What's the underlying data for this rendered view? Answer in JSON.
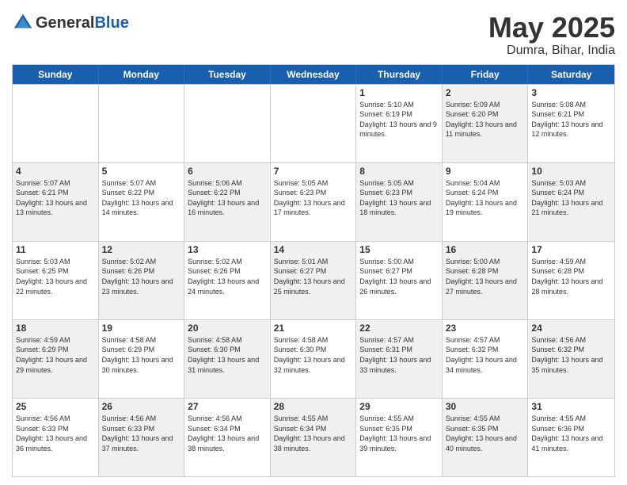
{
  "header": {
    "logo_general": "General",
    "logo_blue": "Blue",
    "title": "May 2025",
    "location": "Dumra, Bihar, India"
  },
  "days_of_week": [
    "Sunday",
    "Monday",
    "Tuesday",
    "Wednesday",
    "Thursday",
    "Friday",
    "Saturday"
  ],
  "rows": [
    [
      {
        "day": "",
        "detail": "",
        "empty": true
      },
      {
        "day": "",
        "detail": "",
        "empty": true
      },
      {
        "day": "",
        "detail": "",
        "empty": true
      },
      {
        "day": "",
        "detail": "",
        "empty": true
      },
      {
        "day": "1",
        "detail": "Sunrise: 5:10 AM\nSunset: 6:19 PM\nDaylight: 13 hours\nand 9 minutes.",
        "empty": false
      },
      {
        "day": "2",
        "detail": "Sunrise: 5:09 AM\nSunset: 6:20 PM\nDaylight: 13 hours\nand 11 minutes.",
        "empty": false
      },
      {
        "day": "3",
        "detail": "Sunrise: 5:08 AM\nSunset: 6:21 PM\nDaylight: 13 hours\nand 12 minutes.",
        "empty": false
      }
    ],
    [
      {
        "day": "4",
        "detail": "Sunrise: 5:07 AM\nSunset: 6:21 PM\nDaylight: 13 hours\nand 13 minutes.",
        "empty": false
      },
      {
        "day": "5",
        "detail": "Sunrise: 5:07 AM\nSunset: 6:22 PM\nDaylight: 13 hours\nand 14 minutes.",
        "empty": false
      },
      {
        "day": "6",
        "detail": "Sunrise: 5:06 AM\nSunset: 6:22 PM\nDaylight: 13 hours\nand 16 minutes.",
        "empty": false
      },
      {
        "day": "7",
        "detail": "Sunrise: 5:05 AM\nSunset: 6:23 PM\nDaylight: 13 hours\nand 17 minutes.",
        "empty": false
      },
      {
        "day": "8",
        "detail": "Sunrise: 5:05 AM\nSunset: 6:23 PM\nDaylight: 13 hours\nand 18 minutes.",
        "empty": false
      },
      {
        "day": "9",
        "detail": "Sunrise: 5:04 AM\nSunset: 6:24 PM\nDaylight: 13 hours\nand 19 minutes.",
        "empty": false
      },
      {
        "day": "10",
        "detail": "Sunrise: 5:03 AM\nSunset: 6:24 PM\nDaylight: 13 hours\nand 21 minutes.",
        "empty": false
      }
    ],
    [
      {
        "day": "11",
        "detail": "Sunrise: 5:03 AM\nSunset: 6:25 PM\nDaylight: 13 hours\nand 22 minutes.",
        "empty": false
      },
      {
        "day": "12",
        "detail": "Sunrise: 5:02 AM\nSunset: 6:26 PM\nDaylight: 13 hours\nand 23 minutes.",
        "empty": false
      },
      {
        "day": "13",
        "detail": "Sunrise: 5:02 AM\nSunset: 6:26 PM\nDaylight: 13 hours\nand 24 minutes.",
        "empty": false
      },
      {
        "day": "14",
        "detail": "Sunrise: 5:01 AM\nSunset: 6:27 PM\nDaylight: 13 hours\nand 25 minutes.",
        "empty": false
      },
      {
        "day": "15",
        "detail": "Sunrise: 5:00 AM\nSunset: 6:27 PM\nDaylight: 13 hours\nand 26 minutes.",
        "empty": false
      },
      {
        "day": "16",
        "detail": "Sunrise: 5:00 AM\nSunset: 6:28 PM\nDaylight: 13 hours\nand 27 minutes.",
        "empty": false
      },
      {
        "day": "17",
        "detail": "Sunrise: 4:59 AM\nSunset: 6:28 PM\nDaylight: 13 hours\nand 28 minutes.",
        "empty": false
      }
    ],
    [
      {
        "day": "18",
        "detail": "Sunrise: 4:59 AM\nSunset: 6:29 PM\nDaylight: 13 hours\nand 29 minutes.",
        "empty": false
      },
      {
        "day": "19",
        "detail": "Sunrise: 4:58 AM\nSunset: 6:29 PM\nDaylight: 13 hours\nand 30 minutes.",
        "empty": false
      },
      {
        "day": "20",
        "detail": "Sunrise: 4:58 AM\nSunset: 6:30 PM\nDaylight: 13 hours\nand 31 minutes.",
        "empty": false
      },
      {
        "day": "21",
        "detail": "Sunrise: 4:58 AM\nSunset: 6:30 PM\nDaylight: 13 hours\nand 32 minutes.",
        "empty": false
      },
      {
        "day": "22",
        "detail": "Sunrise: 4:57 AM\nSunset: 6:31 PM\nDaylight: 13 hours\nand 33 minutes.",
        "empty": false
      },
      {
        "day": "23",
        "detail": "Sunrise: 4:57 AM\nSunset: 6:32 PM\nDaylight: 13 hours\nand 34 minutes.",
        "empty": false
      },
      {
        "day": "24",
        "detail": "Sunrise: 4:56 AM\nSunset: 6:32 PM\nDaylight: 13 hours\nand 35 minutes.",
        "empty": false
      }
    ],
    [
      {
        "day": "25",
        "detail": "Sunrise: 4:56 AM\nSunset: 6:33 PM\nDaylight: 13 hours\nand 36 minutes.",
        "empty": false
      },
      {
        "day": "26",
        "detail": "Sunrise: 4:56 AM\nSunset: 6:33 PM\nDaylight: 13 hours\nand 37 minutes.",
        "empty": false
      },
      {
        "day": "27",
        "detail": "Sunrise: 4:56 AM\nSunset: 6:34 PM\nDaylight: 13 hours\nand 38 minutes.",
        "empty": false
      },
      {
        "day": "28",
        "detail": "Sunrise: 4:55 AM\nSunset: 6:34 PM\nDaylight: 13 hours\nand 38 minutes.",
        "empty": false
      },
      {
        "day": "29",
        "detail": "Sunrise: 4:55 AM\nSunset: 6:35 PM\nDaylight: 13 hours\nand 39 minutes.",
        "empty": false
      },
      {
        "day": "30",
        "detail": "Sunrise: 4:55 AM\nSunset: 6:35 PM\nDaylight: 13 hours\nand 40 minutes.",
        "empty": false
      },
      {
        "day": "31",
        "detail": "Sunrise: 4:55 AM\nSunset: 6:36 PM\nDaylight: 13 hours\nand 41 minutes.",
        "empty": false
      }
    ]
  ]
}
